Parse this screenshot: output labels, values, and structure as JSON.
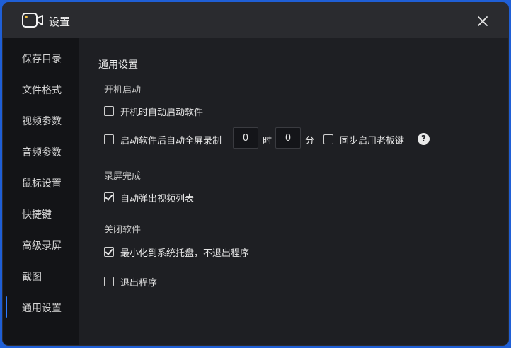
{
  "window": {
    "title": "设置"
  },
  "sidebar": {
    "items": [
      {
        "label": "保存目录"
      },
      {
        "label": "文件格式"
      },
      {
        "label": "视频参数"
      },
      {
        "label": "音频参数"
      },
      {
        "label": "鼠标设置"
      },
      {
        "label": "快捷键"
      },
      {
        "label": "高级录屏"
      },
      {
        "label": "截图"
      },
      {
        "label": "通用设置",
        "active": true
      }
    ]
  },
  "main": {
    "heading": "通用设置",
    "startup": {
      "title": "开机启动",
      "autostart_label": "开机时自动启动软件",
      "autostart_checked": false,
      "fullscreen_label": "启动软件后自动全屏录制",
      "fullscreen_checked": false,
      "hours_value": "0",
      "hours_unit": "时",
      "minutes_value": "0",
      "minutes_unit": "分",
      "boss_key_label": "同步启用老板键",
      "boss_key_checked": false,
      "help_glyph": "?"
    },
    "record_done": {
      "title": "录屏完成",
      "popup_label": "自动弹出视频列表",
      "popup_checked": true
    },
    "close_software": {
      "title": "关闭软件",
      "minimize_label": "最小化到系统托盘，不退出程序",
      "minimize_checked": true,
      "exit_label": "退出程序",
      "exit_checked": false
    }
  },
  "colors": {
    "accent": "#2e7bff",
    "background": "#1e1f23",
    "sidebar": "#131417",
    "titlebar": "#2a2b2f"
  }
}
